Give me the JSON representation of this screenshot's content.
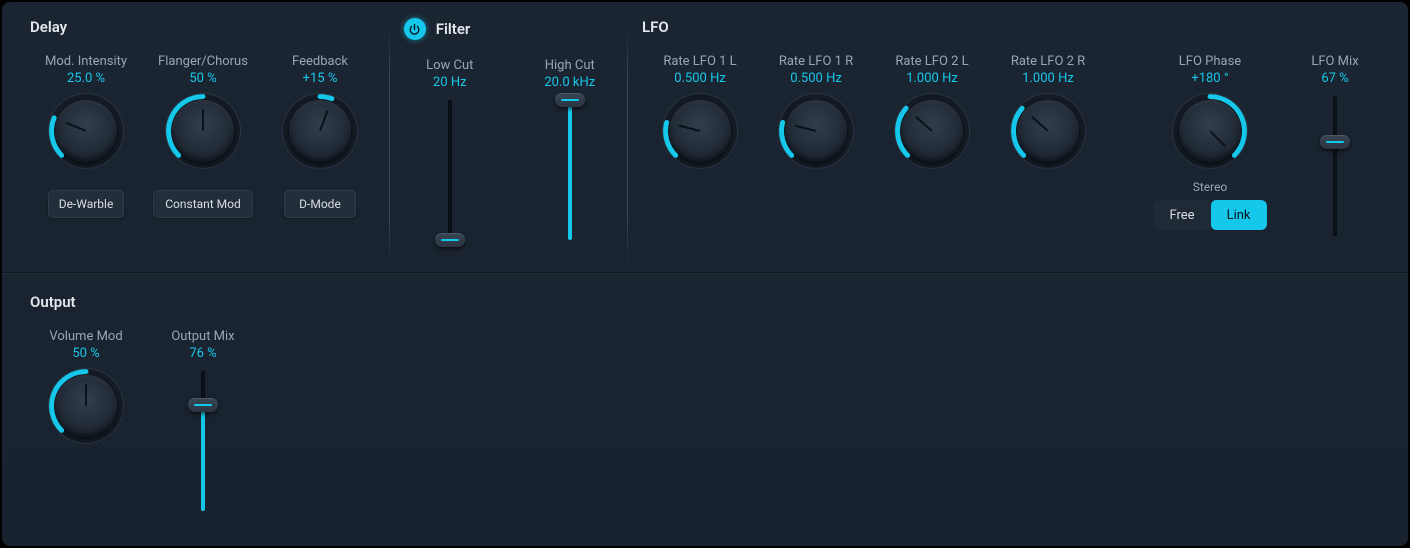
{
  "sections": {
    "delay": {
      "title": "Delay"
    },
    "filter": {
      "title": "Filter"
    },
    "lfo": {
      "title": "LFO"
    },
    "output": {
      "title": "Output"
    }
  },
  "delay": {
    "mod_intensity": {
      "label": "Mod. Intensity",
      "value": "25.0 %",
      "norm": 0.25
    },
    "flanger_chorus": {
      "label": "Flanger/Chorus",
      "value": "50 %",
      "norm": 0.5
    },
    "feedback": {
      "label": "Feedback",
      "value": "+15 %",
      "bipolar": 0.15
    },
    "buttons": {
      "dewarble": "De-Warble",
      "constant_mod": "Constant Mod",
      "dmode": "D-Mode"
    }
  },
  "filter": {
    "power_on": true,
    "low_cut": {
      "label": "Low Cut",
      "value": "20 Hz",
      "norm": 0.0
    },
    "high_cut": {
      "label": "High Cut",
      "value": "20.0 kHz",
      "norm": 1.0
    }
  },
  "lfo": {
    "rate_1l": {
      "label": "Rate LFO 1 L",
      "value": "0.500 Hz",
      "norm": 0.22
    },
    "rate_1r": {
      "label": "Rate LFO 1 R",
      "value": "0.500 Hz",
      "norm": 0.22
    },
    "rate_2l": {
      "label": "Rate LFO 2 L",
      "value": "1.000 Hz",
      "norm": 0.32
    },
    "rate_2r": {
      "label": "Rate LFO 2 R",
      "value": "1.000 Hz",
      "norm": 0.32
    },
    "phase": {
      "label": "LFO Phase",
      "value": "+180 °",
      "bipolar": 1.0
    },
    "mix": {
      "label": "LFO Mix",
      "value": "67 %",
      "norm": 0.67
    },
    "stereo_label": "Stereo",
    "stereo_options": {
      "free": "Free",
      "link": "Link"
    },
    "stereo_active": "link"
  },
  "output": {
    "volume_mod": {
      "label": "Volume Mod",
      "value": "50 %",
      "norm": 0.5
    },
    "output_mix": {
      "label": "Output Mix",
      "value": "76 %",
      "norm": 0.76
    }
  }
}
